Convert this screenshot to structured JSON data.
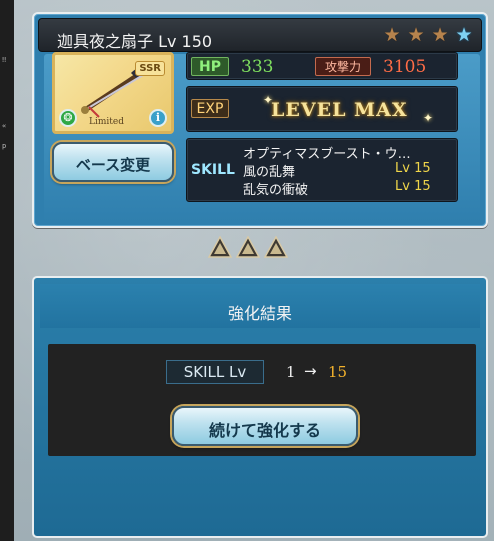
{
  "item": {
    "name_level": "迦具夜之扇子 Lv 150",
    "rarity_badge": "SSR",
    "limited_label": "Limited",
    "stars": [
      "bronze",
      "bronze",
      "bronze",
      "blue"
    ]
  },
  "stats": {
    "hp_label": "HP",
    "hp_value": "333",
    "atk_label": "攻撃力",
    "atk_value": "3105",
    "exp_label": "EXP",
    "level_status": "LEVEL MAX"
  },
  "skill": {
    "label": "SKILL",
    "lines": [
      {
        "name": "オプティマスブースト・ウ…",
        "level": ""
      },
      {
        "name": "風の乱舞",
        "level": "Lv 15"
      },
      {
        "name": "乱気の衝破",
        "level": "Lv 15"
      }
    ]
  },
  "buttons": {
    "change_base": "ベース変更",
    "continue_upgrade": "続けて強化する"
  },
  "result": {
    "title": "強化結果",
    "skill_lv_label": "SKILL Lv",
    "from": "1",
    "arrow": "→",
    "to": "15"
  },
  "icons": {
    "wind": "wind-element-icon",
    "info": "info-icon",
    "upgrade_arrows": "up-arrow-icon"
  }
}
